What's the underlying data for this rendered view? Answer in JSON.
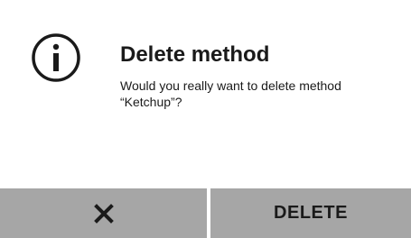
{
  "dialog": {
    "icon": "info-circle-icon",
    "title": "Delete method",
    "message_line1": "Would you really want to delete method",
    "message_line2": "“Ketchup”?"
  },
  "buttons": {
    "cancel_icon": "close-icon",
    "delete_label": "DELETE"
  },
  "colors": {
    "background": "#ffffff",
    "button_bar": "#a6a6a6",
    "text": "#1a1a1a"
  }
}
